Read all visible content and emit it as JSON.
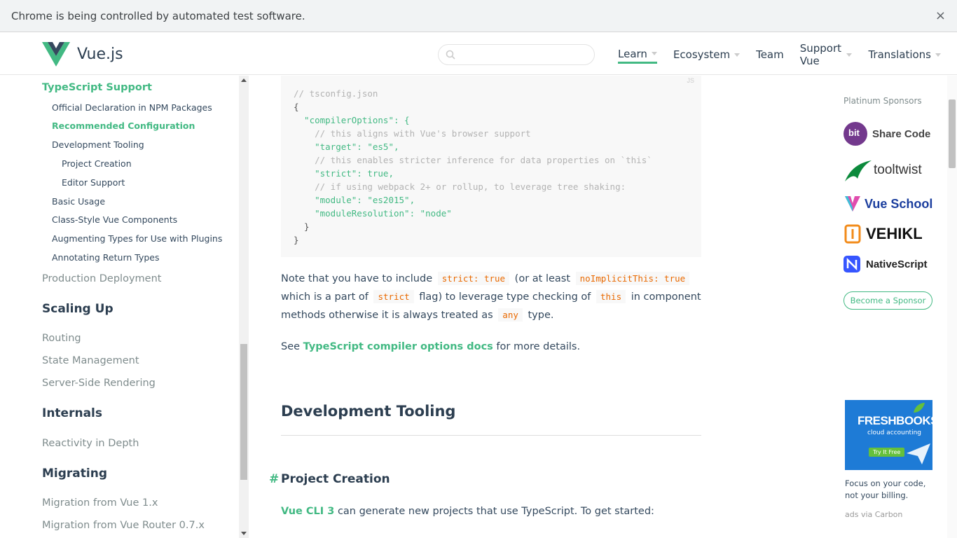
{
  "infobar": {
    "message": "Chrome is being controlled by automated test software.",
    "close": "×"
  },
  "header": {
    "logo_text": "Vue.js",
    "search_placeholder": "",
    "nav": [
      {
        "label": "Learn",
        "active": true
      },
      {
        "label": "Ecosystem"
      },
      {
        "label": "Team"
      },
      {
        "label": "Support Vue"
      },
      {
        "label": "Translations"
      }
    ]
  },
  "sidebar": {
    "items": [
      {
        "label": "TypeScript Support"
      },
      {
        "label": "Official Declaration in NPM Packages"
      },
      {
        "label": "Recommended Configuration"
      },
      {
        "label": "Development Tooling"
      },
      {
        "label": "Project Creation"
      },
      {
        "label": "Editor Support"
      },
      {
        "label": "Basic Usage"
      },
      {
        "label": "Class-Style Vue Components"
      },
      {
        "label": "Augmenting Types for Use with Plugins"
      },
      {
        "label": "Annotating Return Types"
      },
      {
        "label": "Production Deployment"
      },
      {
        "label": "Scaling Up"
      },
      {
        "label": "Routing"
      },
      {
        "label": "State Management"
      },
      {
        "label": "Server-Side Rendering"
      },
      {
        "label": "Internals"
      },
      {
        "label": "Reactivity in Depth"
      },
      {
        "label": "Migrating"
      },
      {
        "label": "Migration from Vue 1.x"
      },
      {
        "label": "Migration from Vue Router 0.7.x"
      }
    ]
  },
  "code": {
    "lang": "JS",
    "lines": [
      "// tsconfig.json",
      "{",
      "  \"compilerOptions\": {",
      "    // this aligns with Vue's browser support",
      "    \"target\": \"es5\",",
      "    // this enables stricter inference for data properties on `this`",
      "    \"strict\": true,",
      "    // if using webpack 2+ or rollup, to leverage tree shaking:",
      "    \"module\": \"es2015\",",
      "    \"moduleResolution\": \"node\"",
      "  }",
      "}"
    ]
  },
  "content": {
    "p1_a": "Note that you have to include",
    "p1_code1": "strict: true",
    "p1_b": "(or at least",
    "p1_code2": "noImplicitThis: true",
    "p2_a": "which is a part of",
    "p2_code": "strict",
    "p2_b": "flag) to leverage type checking of",
    "p2_code2": "this",
    "p2_c": "in component",
    "p3_a": "methods otherwise it is always treated as",
    "p3_code": "any",
    "p3_b": "type.",
    "p4_a": "See",
    "p4_link": "TypeScript compiler options docs",
    "p4_b": "for more details.",
    "h2": "Development Tooling",
    "h3_anchor": "#",
    "h3": "Project Creation",
    "p5_link": "Vue CLI 3",
    "p5_b": "can generate new projects that use TypeScript. To get started:"
  },
  "sponsors": {
    "title": "Platinum Sponsors",
    "items": [
      {
        "name": "Share Code",
        "badge": "bit",
        "color": "#73398d"
      },
      {
        "name": "tooltwist",
        "color": "#0c8a3c"
      },
      {
        "name": "Vue School",
        "color": "#1b3e9e"
      },
      {
        "name": "VEHIKL",
        "color": "#111111"
      },
      {
        "name": "NativeScript",
        "color": "#3655ff"
      }
    ],
    "become": "Become a Sponsor"
  },
  "ad": {
    "logo": "FRESHBOOKS",
    "sub": "cloud accounting",
    "button": "Try It Free",
    "text": "Focus on your code, not your billing.",
    "via": "ads via Carbon"
  },
  "colors": {
    "accent": "#42b983",
    "text": "#2c3e50",
    "inline_code": "#e96900"
  }
}
